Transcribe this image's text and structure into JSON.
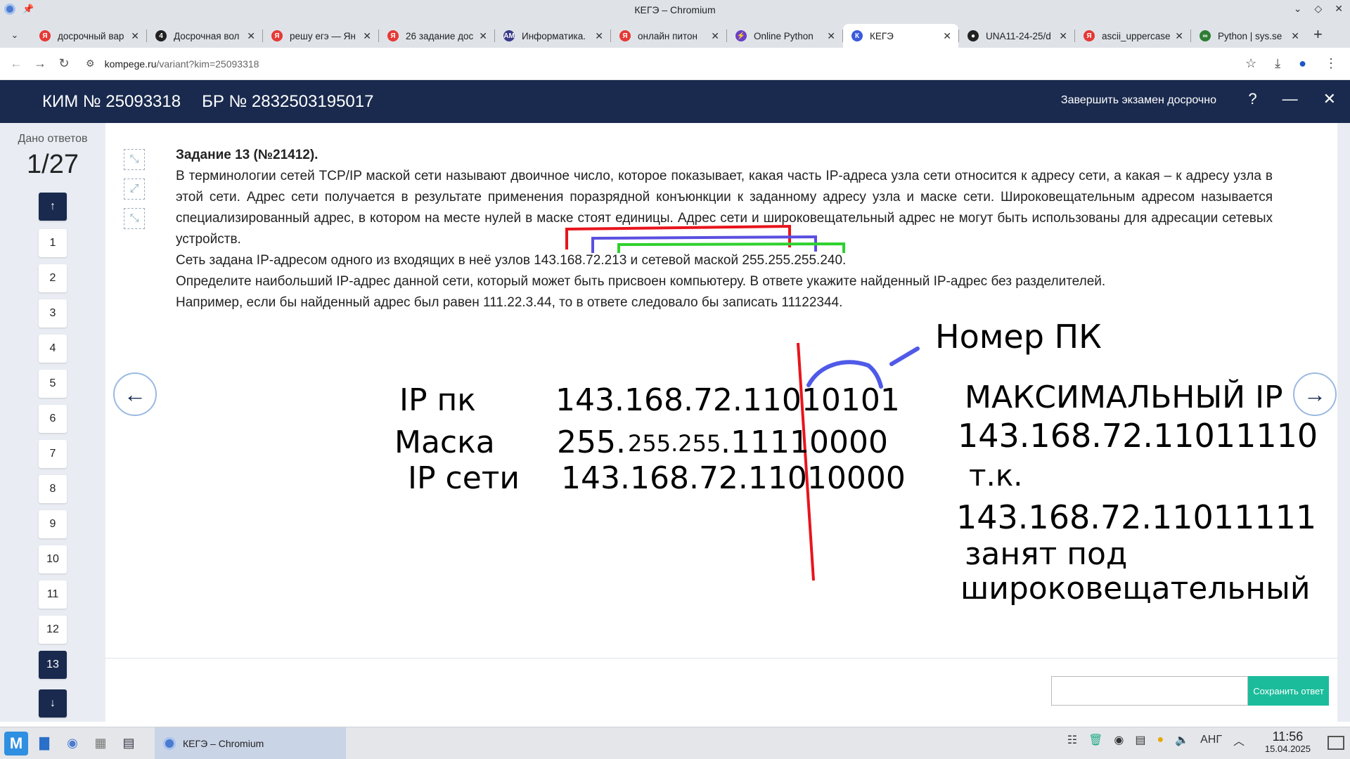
{
  "window": {
    "title": "КЕГЭ – Chromium"
  },
  "tabs": [
    {
      "label": "досрочный вар",
      "color": "#e53935",
      "glyph": "Я"
    },
    {
      "label": "Досрочная вол",
      "color": "#222222",
      "glyph": "4"
    },
    {
      "label": "решу егэ — Ян",
      "color": "#e53935",
      "glyph": "Я"
    },
    {
      "label": "26 задание дос",
      "color": "#e53935",
      "glyph": "Я"
    },
    {
      "label": "Информатика.",
      "color": "#3a3a8a",
      "glyph": "AM"
    },
    {
      "label": "онлайн питон",
      "color": "#e53935",
      "glyph": "Я"
    },
    {
      "label": "Online Python",
      "color": "#6a3fc8",
      "glyph": "⚡"
    },
    {
      "label": "КЕГЭ",
      "color": "#3b5bdb",
      "glyph": "К"
    },
    {
      "label": "UNA11-24-25/d",
      "color": "#222222",
      "glyph": "●"
    },
    {
      "label": "ascii_uppercase",
      "color": "#e53935",
      "glyph": "Я"
    },
    {
      "label": "Python | sys.se",
      "color": "#2e7d32",
      "glyph": "∞"
    }
  ],
  "address": {
    "host": "kompege.ru",
    "path": "/variant?kim=25093318"
  },
  "header": {
    "kim": "КИМ № 25093318",
    "br": "БР № 2832503195017",
    "finish": "Завершить экзамен досрочно",
    "help": "?"
  },
  "sidebar": {
    "title": "Дано ответов",
    "count": "1/27",
    "up": "↑",
    "down": "↓",
    "items": [
      "1",
      "2",
      "3",
      "4",
      "5",
      "6",
      "7",
      "8",
      "9",
      "10",
      "11",
      "12",
      "13"
    ]
  },
  "task": {
    "title": "Задание 13 (№21412).",
    "p1": "В терминологии сетей TCP/IP маской сети называют двоичное число, которое показывает, какая часть IP-адреса узла сети относится к адресу сети, а какая –  к адресу узла в этой сети. Адрес сети получается в результате применения поразрядной конъюнкции к заданному адресу узла и маске сети. Широковещательным адресом называется специализированный адрес, в котором на месте нулей в маске стоят единицы. Адрес сети и широковещательный адрес не могут быть использованы для адресации сетевых устройств.",
    "p2": "Сеть задана IP-адресом одного из входящих в неё узлов 143.168.72.213 и сетевой маской 255.255.255.240.",
    "p3": "Определите наибольший IP-адрес данной сети, который может быть присвоен компьютеру. В ответе укажите найденный IP-адрес без разделителей.",
    "p4": "Например, если бы найденный адрес был равен 111.22.3.44, то в ответе следовало бы записать 11122344."
  },
  "handwriting": {
    "nomer_pk": "Номер ПК",
    "ip_pk_label": "IP пк",
    "ip_pk_value": "143.168.72.11010101",
    "mask_label": "Маска",
    "mask_a": "255.",
    "mask_b": "255.255",
    "mask_c": ".11110000",
    "net_label": "IP сети",
    "net_value": "143.168.72.11010000",
    "max_title": "МАКСИМАЛЬНЫЙ IP",
    "max_value": "143.168.72.11011110",
    "tk": "т.к.",
    "bc_value": "143.168.72.11011111",
    "zanyat": "занят под",
    "broadcast": "широковещательный"
  },
  "nav": {
    "prev": "←",
    "next": "→"
  },
  "answer": {
    "value": "",
    "save": "Сохранить ответ"
  },
  "taskbar": {
    "app": "КЕГЭ – Chromium",
    "lang": "АНГ",
    "time": "11:56",
    "date": "15.04.2025"
  }
}
